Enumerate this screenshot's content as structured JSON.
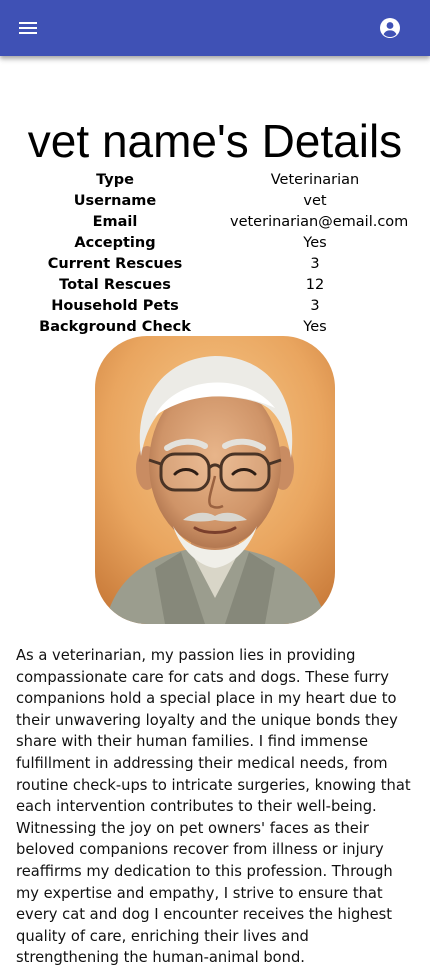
{
  "app_bar": {
    "color": "#3f51b5",
    "menu_icon": "hamburger-menu-icon",
    "account_icon": "account-circle-icon"
  },
  "page": {
    "title": "vet name's Details"
  },
  "details": [
    {
      "label": "Type",
      "value": "Veterinarian"
    },
    {
      "label": "Username",
      "value": "vet"
    },
    {
      "label": "Email",
      "value": "veterinarian@email.com"
    },
    {
      "label": "Accepting",
      "value": "Yes"
    },
    {
      "label": "Current Rescues",
      "value": "3"
    },
    {
      "label": "Total Rescues",
      "value": "12"
    },
    {
      "label": "Household Pets",
      "value": "3"
    },
    {
      "label": "Background Check",
      "value": "Yes"
    }
  ],
  "profile_image": {
    "subject": "portrait of an elderly man with white hair, glasses and a white beard, smiling"
  },
  "bio": "As a veterinarian, my passion lies in providing compassionate care for cats and dogs. These furry companions hold a special place in my heart due to their unwavering loyalty and the unique bonds they share with their human families. I find immense fulfillment in addressing their medical needs, from routine check-ups to intricate surgeries, knowing that each intervention contributes to their well-being. Witnessing the joy on pet owners' faces as their beloved companions recover from illness or injury reaffirms my dedication to this profession. Through my expertise and empathy, I strive to ensure that every cat and dog I encounter receives the highest quality of care, enriching their lives and strengthening the human-animal bond."
}
